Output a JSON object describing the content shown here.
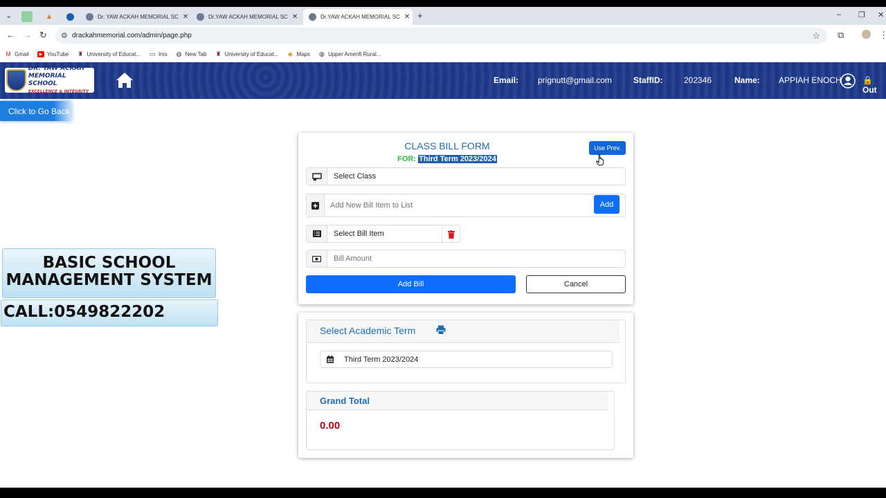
{
  "browser": {
    "tabs": [
      {
        "label": "Dr. YAW ACKAH MEMORIAL SC"
      },
      {
        "label": "Dr.YAW ACKAH MEMORIAL SC"
      },
      {
        "label": "Dr.YAW ACKAH MEMORIAL SC"
      }
    ],
    "url": "drackahmemorial.com/admin/page.php",
    "bookmarks": [
      {
        "label": "Gmail",
        "icon": "gmail-icon"
      },
      {
        "label": "YouTube",
        "icon": "youtube-icon"
      },
      {
        "label": "University of Educat...",
        "icon": "university-icon"
      },
      {
        "label": "lms",
        "icon": "folder-icon"
      },
      {
        "label": "New Tab",
        "icon": "globe-icon"
      },
      {
        "label": "University of Educat...",
        "icon": "university-icon"
      },
      {
        "label": "Maps",
        "icon": "maps-icon"
      },
      {
        "label": "Upper Amenfi Rural...",
        "icon": "globe-icon"
      }
    ]
  },
  "header": {
    "logo": {
      "line1": "DR. YAW ACKAH",
      "line2": "MEMORIAL SCHOOL",
      "line3": "EXCELLENCE & INTEGRITY"
    },
    "email_label": "Email:",
    "email_value": "prignutt@gmail.com",
    "staff_label": "StaffID:",
    "staff_value": "202346",
    "name_label": "Name:",
    "name_value": "APPIAH ENOCH",
    "logout_label": "Out"
  },
  "back_button": "Click to Go Back",
  "promo": {
    "title_line1": "BASIC SCHOOL",
    "title_line2": "MANAGEMENT SYSTEM",
    "call": "CALL:0549822202"
  },
  "form": {
    "title": "CLASS BILL FORM",
    "for_label": "FOR:",
    "for_value": "Third Term 2023/2024",
    "use_prev": "Use Prev.",
    "select_class": "Select Class",
    "new_item_placeholder": "Add New Bill Item to List",
    "add_label": "Add",
    "select_bill_item": "Select Bill Item",
    "bill_amount_placeholder": "Bill Amount",
    "add_bill": "Add Bill",
    "cancel": "Cancel"
  },
  "term": {
    "title": "Select Academic Term",
    "selected": "Third Term 2023/2024"
  },
  "grand_total": {
    "title": "Grand Total",
    "value": "0.00"
  },
  "colors": {
    "accent": "#0d6efd",
    "header_bg": "#1d3480",
    "total": "#c30010",
    "for_label": "#2dbf3b"
  }
}
